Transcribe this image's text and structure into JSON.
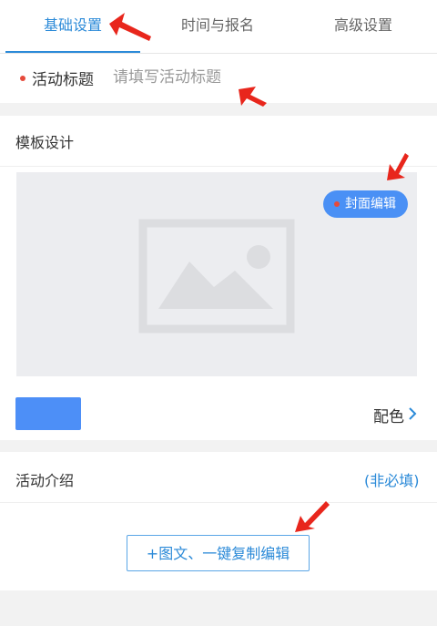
{
  "tabs": [
    {
      "label": "基础设置",
      "active": true
    },
    {
      "label": "时间与报名",
      "active": false
    },
    {
      "label": "高级设置",
      "active": false
    }
  ],
  "title_field": {
    "label": "活动标题",
    "placeholder": "请填写活动标题",
    "value": ""
  },
  "template_section": {
    "title": "模板设计",
    "cover_button_label": "封面编辑",
    "color_label": "配色",
    "selected_color": "#4d8ff7",
    "image_placeholder_icon": "image-placeholder-icon"
  },
  "intro_section": {
    "title": "活动介绍",
    "optional_label": "(非必填)",
    "add_button_label": "+图文、一键复制编辑"
  },
  "colors": {
    "accent": "#2b8ad8",
    "button_blue": "#4a90f5",
    "required_dot": "#e64a3b",
    "annotation_arrow": "#e8261c"
  }
}
